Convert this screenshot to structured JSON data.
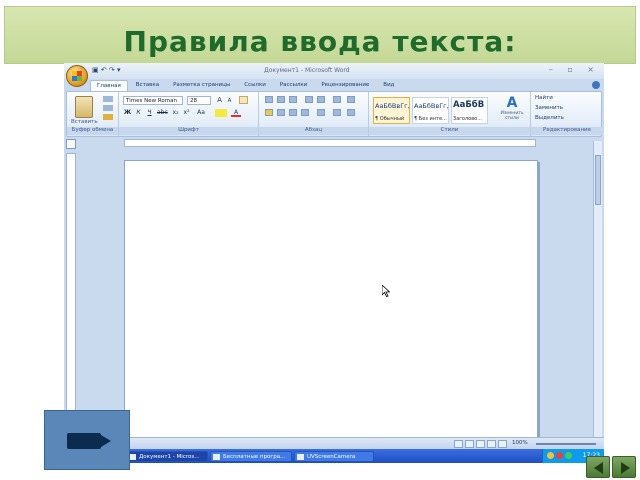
{
  "slide": {
    "title": "Правила ввода текста:"
  },
  "word": {
    "caption": "Документ1 - Microsoft Word",
    "qat": "▣ ↶ ↷ ▾",
    "window_controls": "– ▫ ×",
    "tabs": [
      {
        "label": "Главная",
        "active": true
      },
      {
        "label": "Вставка",
        "active": false
      },
      {
        "label": "Разметка страницы",
        "active": false
      },
      {
        "label": "Ссылки",
        "active": false
      },
      {
        "label": "Рассылки",
        "active": false
      },
      {
        "label": "Рецензирование",
        "active": false
      },
      {
        "label": "Вид",
        "active": false
      }
    ],
    "ribbon": {
      "clipboard": {
        "label": "Буфер обмена",
        "paste": "Вставить"
      },
      "font": {
        "label": "Шрифт",
        "font_name": "Times New Roman",
        "font_size": "28",
        "bold": "Ж",
        "italic": "К",
        "underline": "Ч",
        "grow": "A",
        "shrink": "A",
        "clear": "Aa",
        "color": "A"
      },
      "paragraph": {
        "label": "Абзац"
      },
      "styles": {
        "label": "Стили",
        "items": [
          {
            "sample": "АаБбВвГг,",
            "name": "¶ Обычный",
            "selected": true,
            "big": false
          },
          {
            "sample": "АаБбВвГг,",
            "name": "¶ Без инте...",
            "selected": false,
            "big": false
          },
          {
            "sample": "АаБбВ",
            "name": "Заголово...",
            "selected": false,
            "big": true
          }
        ],
        "change_label": "Изменить стили",
        "change_icon": "A"
      },
      "editing": {
        "label": "Редактирование",
        "find": "Найти",
        "replace": "Заменить",
        "select": "Выделить"
      }
    },
    "status": {
      "zoom": "100%"
    }
  },
  "taskbar": {
    "buttons": [
      {
        "label": "Документ1 - Micros...",
        "active": true
      },
      {
        "label": "Бесплатные програ...",
        "active": false
      },
      {
        "label": "UVScreenCamera",
        "active": false
      }
    ],
    "clock": "17:23",
    "tray_colors": [
      "#f2c230",
      "#e8403a",
      "#3ccf5a"
    ]
  },
  "colors": {
    "title": "#1f6b2c",
    "title_band": "#c4d896",
    "nav_button": "#4b7a34",
    "taskbar": "#1e4fc2"
  },
  "icons": {
    "media": "camera-icon",
    "prev": "arrow-left-icon",
    "next": "arrow-right-icon",
    "cursor": "mouse-pointer-icon"
  }
}
